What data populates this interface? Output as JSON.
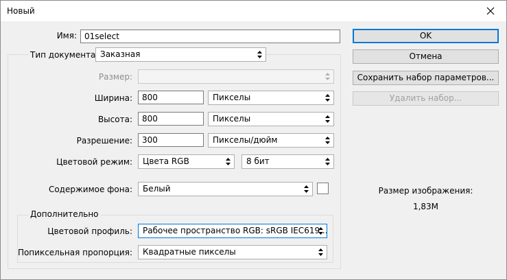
{
  "window": {
    "title": "Новый"
  },
  "name": {
    "label": "Имя:",
    "value": "01select"
  },
  "document_type": {
    "label": "Тип документа:",
    "value": "Заказная"
  },
  "size": {
    "label": "Размер:",
    "value": ""
  },
  "width": {
    "label": "Ширина:",
    "value": "800",
    "unit": "Пикселы"
  },
  "height": {
    "label": "Высота:",
    "value": "800",
    "unit": "Пикселы"
  },
  "resolution": {
    "label": "Разрешение:",
    "value": "300",
    "unit": "Пикселы/дюйм"
  },
  "color_mode": {
    "label": "Цветовой режим:",
    "value": "Цвета RGB",
    "depth": "8 бит"
  },
  "background": {
    "label": "Содержимое фона:",
    "value": "Белый",
    "swatch_color": "#ffffff"
  },
  "advanced": {
    "legend": "Дополнительно",
    "color_profile": {
      "label": "Цветовой профиль:",
      "value": "Рабочее пространство RGB:  sRGB IEC619..."
    },
    "pixel_aspect": {
      "label": "Попиксельная пропорция:",
      "value": "Квадратные пикселы"
    }
  },
  "buttons": {
    "ok": "OK",
    "cancel": "Отмена",
    "save_preset": "Сохранить набор параметров...",
    "delete_preset": "Удалить набор..."
  },
  "image_size": {
    "label": "Размер изображения:",
    "value": "1,83M"
  },
  "colors": {
    "accent": "#0078d7",
    "disabled_text": "#8d8d8d"
  }
}
